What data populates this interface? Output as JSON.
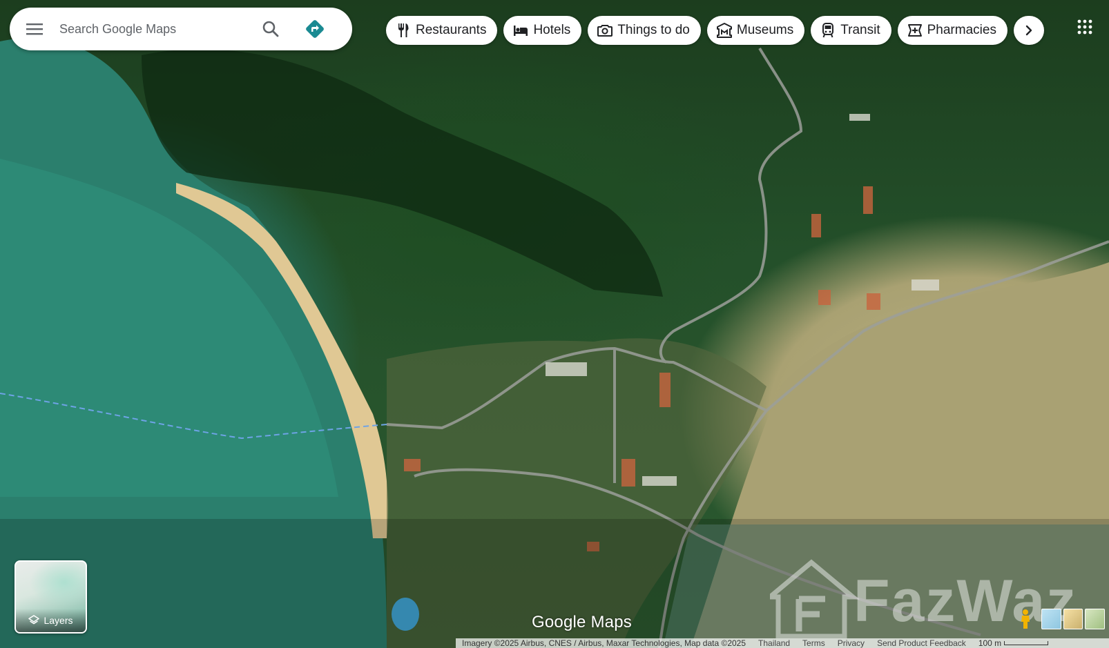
{
  "search": {
    "placeholder": "Search Google Maps"
  },
  "chips": [
    {
      "label": "Restaurants",
      "icon": "restaurant-icon"
    },
    {
      "label": "Hotels",
      "icon": "hotel-icon"
    },
    {
      "label": "Things to do",
      "icon": "camera-icon"
    },
    {
      "label": "Museums",
      "icon": "museum-icon"
    },
    {
      "label": "Transit",
      "icon": "transit-icon"
    },
    {
      "label": "Pharmacies",
      "icon": "pharmacy-icon"
    }
  ],
  "layers": {
    "label": "Layers"
  },
  "branding": {
    "logo": "Google Maps",
    "watermark": "FazWaz"
  },
  "attribution": {
    "imagery": "Imagery ©2025 Airbus, CNES / Airbus, Maxar Technologies, Map data ©2025",
    "country": "Thailand",
    "terms": "Terms",
    "privacy": "Privacy",
    "feedback": "Send Product Feedback",
    "scale": "100 m"
  },
  "colors": {
    "accent": "#1a73e8",
    "directions": "#1a8a92"
  }
}
